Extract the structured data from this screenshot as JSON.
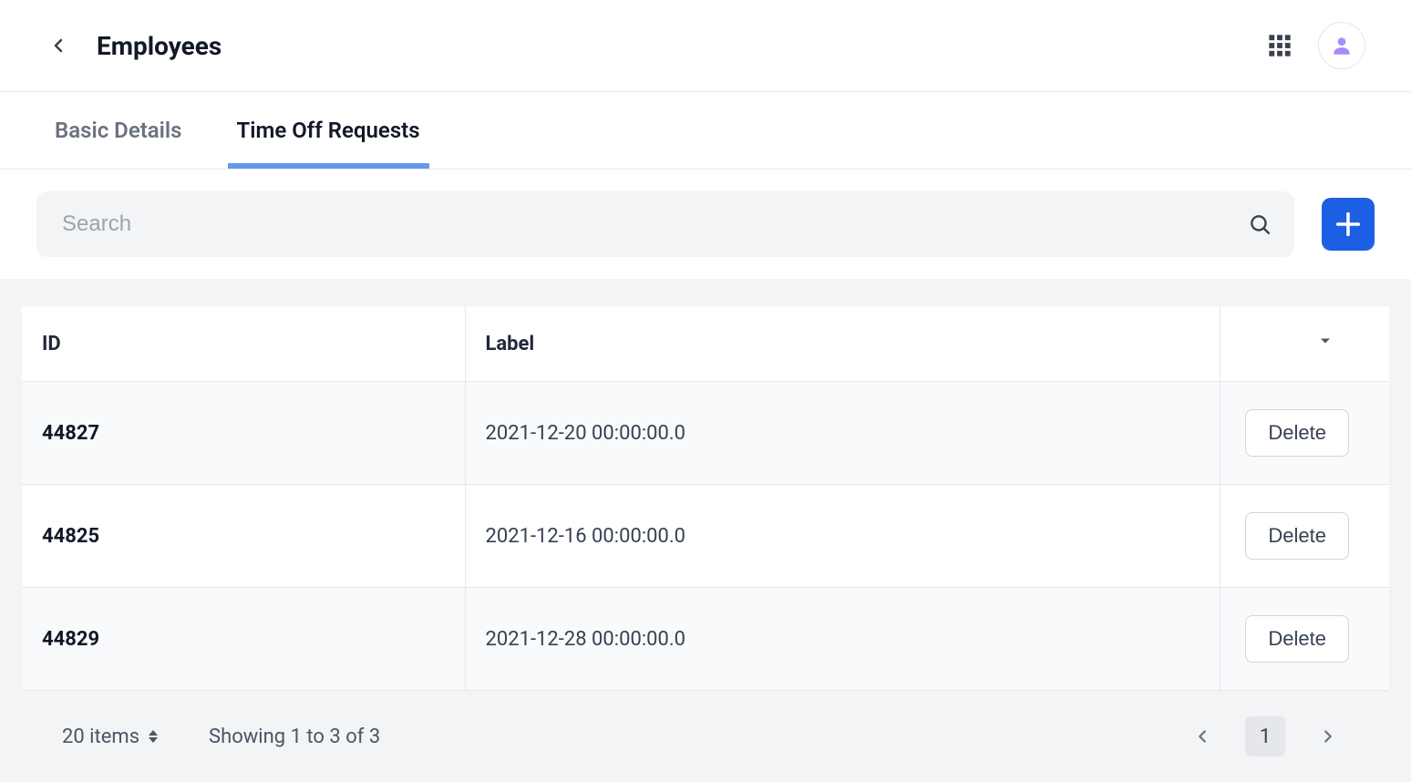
{
  "header": {
    "title": "Employees"
  },
  "tabs": [
    {
      "label": "Basic Details",
      "active": false
    },
    {
      "label": "Time Off Requests",
      "active": true
    }
  ],
  "search": {
    "placeholder": "Search",
    "value": ""
  },
  "table": {
    "columns": {
      "id": "ID",
      "label": "Label"
    },
    "rows": [
      {
        "id": "44827",
        "label": "2021-12-20 00:00:00.0",
        "action": "Delete"
      },
      {
        "id": "44825",
        "label": "2021-12-16 00:00:00.0",
        "action": "Delete"
      },
      {
        "id": "44829",
        "label": "2021-12-28 00:00:00.0",
        "action": "Delete"
      }
    ]
  },
  "footer": {
    "page_size_label": "20 items",
    "summary": "Showing 1 to 3 of 3",
    "current_page": "1"
  }
}
